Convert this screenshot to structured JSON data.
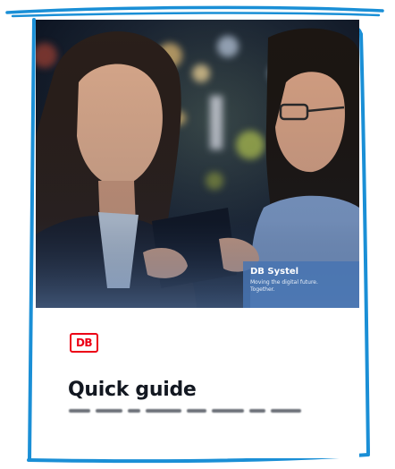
{
  "brochure": {
    "tag": {
      "title": "DB Systel",
      "subtitle_line1": "Moving the digital future.",
      "subtitle_line2": "Together."
    },
    "logo_text": "DB",
    "heading": "Quick guide"
  },
  "colors": {
    "frame_blue": "#1a8fd6",
    "db_red": "#ec0016",
    "tag_blue": "#4874b2",
    "heading_text": "#131821"
  }
}
